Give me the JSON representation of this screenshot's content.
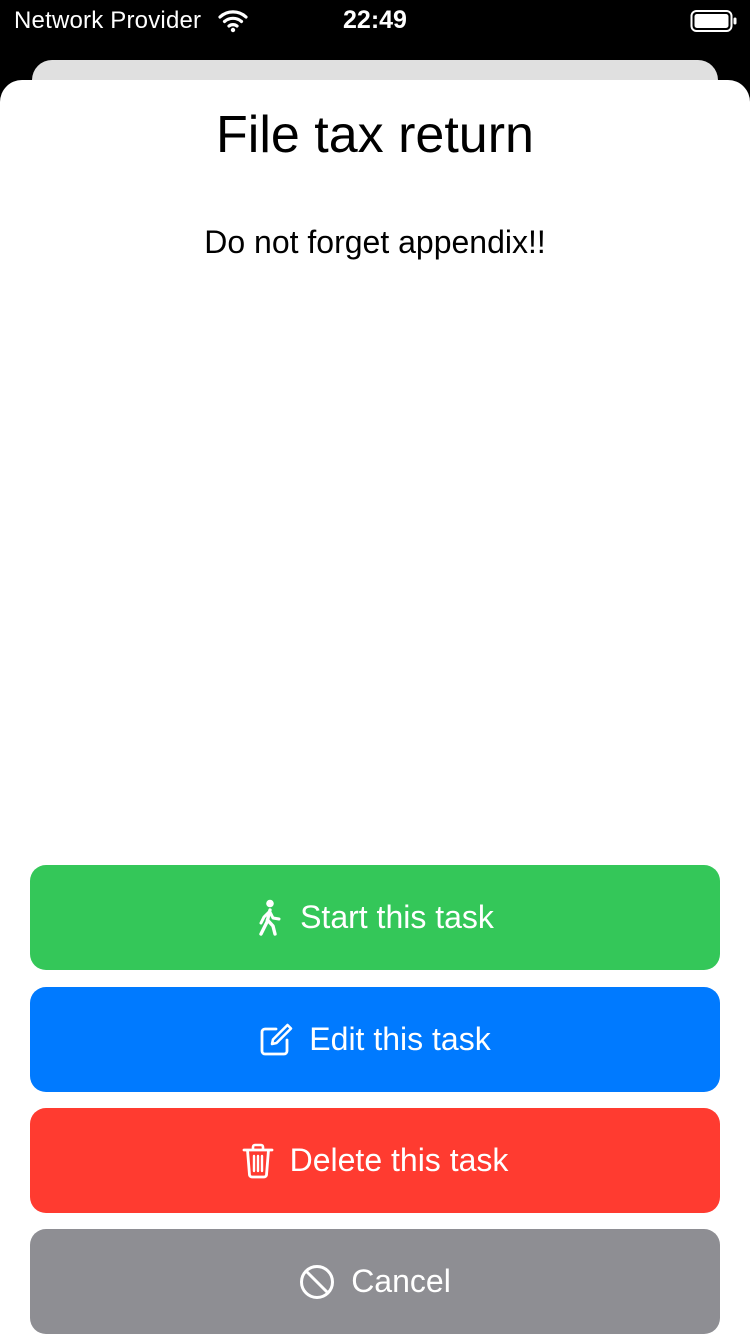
{
  "status_bar": {
    "carrier": "Network Provider",
    "time": "22:49"
  },
  "task": {
    "title": "File tax return",
    "description": "Do not forget appendix!!"
  },
  "actions": {
    "start": {
      "label": "Start this task",
      "icon": "walking-person-icon",
      "color": "#34c759"
    },
    "edit": {
      "label": "Edit this task",
      "icon": "edit-icon",
      "color": "#007aff"
    },
    "delete": {
      "label": "Delete this task",
      "icon": "trash-icon",
      "color": "#ff3b30"
    },
    "cancel": {
      "label": "Cancel",
      "icon": "cancel-icon",
      "color": "#8e8e93"
    }
  }
}
